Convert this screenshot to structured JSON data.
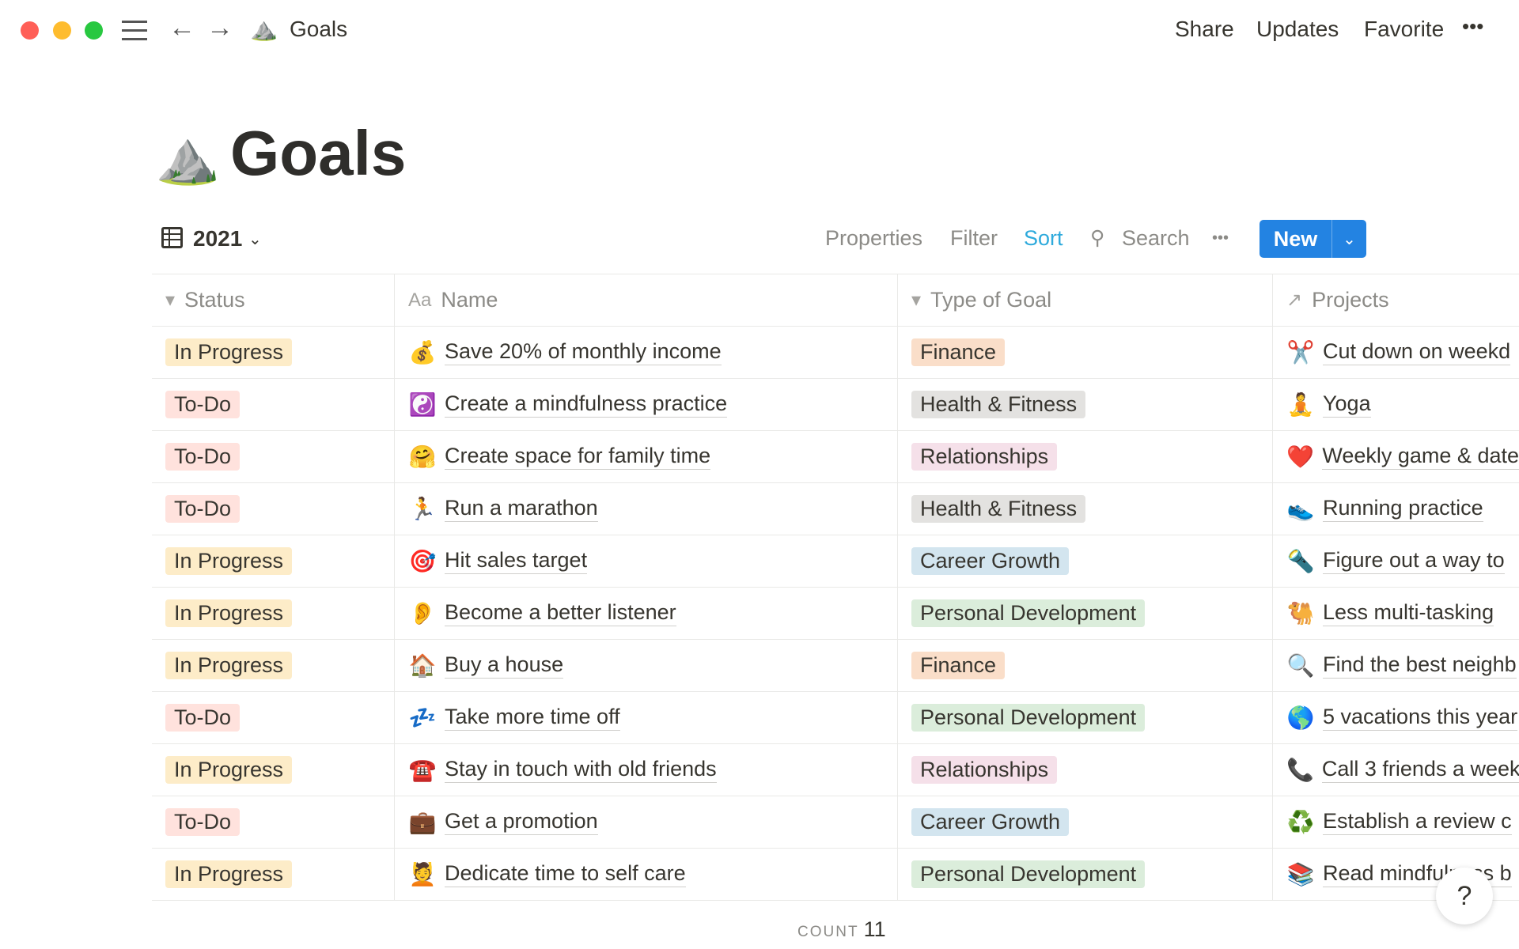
{
  "window": {
    "title": "Goals",
    "page_icon": "mountain-emoji"
  },
  "topbar": {
    "breadcrumb": "Goals",
    "share": "Share",
    "updates": "Updates",
    "favorite": "Favorite",
    "more": "•••"
  },
  "page": {
    "emoji": "⛰️",
    "title": "Goals"
  },
  "view": {
    "name": "2021",
    "properties": "Properties",
    "filter": "Filter",
    "sort": "Sort",
    "search": "Search",
    "more": "•••",
    "new": "New",
    "accent_color": "#2383e2"
  },
  "columns": [
    {
      "label": "Status",
      "icon": "▾"
    },
    {
      "label": "Name",
      "icon": "Aa"
    },
    {
      "label": "Type of Goal",
      "icon": "▾"
    },
    {
      "label": "Projects",
      "icon": "↗"
    }
  ],
  "tag_colors": {
    "In Progress": "#fdecc8",
    "To-Do": "#ffe2dd",
    "Finance": "#fadec9",
    "Health & Fitness": "#e3e2e0",
    "Relationships": "#f5e0e9",
    "Career Growth": "#d3e5ef",
    "Personal Development": "#dbeddb"
  },
  "rows": [
    {
      "status": "In Progress",
      "emoji": "💰",
      "name": "Save 20% of monthly income",
      "type": "Finance",
      "project_emoji": "✂️",
      "project": "Cut down on weekd"
    },
    {
      "status": "To-Do",
      "emoji": "☯️",
      "name": "Create a mindfulness practice",
      "type": "Health & Fitness",
      "project_emoji": "🧘",
      "project": "Yoga"
    },
    {
      "status": "To-Do",
      "emoji": "🤗",
      "name": "Create space for family time",
      "type": "Relationships",
      "project_emoji": "❤️",
      "project": "Weekly game & date"
    },
    {
      "status": "To-Do",
      "emoji": "🏃",
      "name": "Run a marathon",
      "type": "Health & Fitness",
      "project_emoji": "👟",
      "project": "Running practice"
    },
    {
      "status": "In Progress",
      "emoji": "🎯",
      "name": "Hit sales target",
      "type": "Career Growth",
      "project_emoji": "🔦",
      "project": "Figure out a way to"
    },
    {
      "status": "In Progress",
      "emoji": "👂",
      "name": "Become a better listener",
      "type": "Personal Development",
      "project_emoji": "🐫",
      "project": "Less multi-tasking"
    },
    {
      "status": "In Progress",
      "emoji": "🏠",
      "name": "Buy a house",
      "type": "Finance",
      "project_emoji": "🔍",
      "project": "Find the best neighb"
    },
    {
      "status": "To-Do",
      "emoji": "💤",
      "name": "Take more time off",
      "type": "Personal Development",
      "project_emoji": "🌎",
      "project": "5 vacations this year"
    },
    {
      "status": "In Progress",
      "emoji": "☎️",
      "name": "Stay in touch with old friends",
      "type": "Relationships",
      "project_emoji": "📞",
      "project": "Call 3 friends a week"
    },
    {
      "status": "To-Do",
      "emoji": "💼",
      "name": "Get a promotion",
      "type": "Career Growth",
      "project_emoji": "♻️",
      "project": "Establish a review c"
    },
    {
      "status": "In Progress",
      "emoji": "💆",
      "name": "Dedicate time to self care",
      "type": "Personal Development",
      "project_emoji": "📚",
      "project": "Read mindfulness b"
    }
  ],
  "footer": {
    "count_label": "COUNT",
    "count": "11"
  },
  "help": "?"
}
